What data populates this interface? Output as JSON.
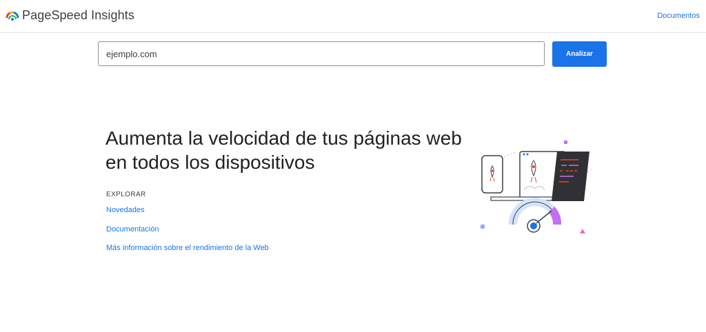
{
  "header": {
    "app_title": "PageSpeed Insights",
    "docs_link": "Documentos"
  },
  "search": {
    "value": "ejemplo.com",
    "button_label": "Analizar"
  },
  "hero": {
    "title_line1": "Aumenta la velocidad de tus páginas web",
    "title_line2": "en todos los dispositivos"
  },
  "explore": {
    "label": "EXPLORAR",
    "links": [
      "Novedades",
      "Documentación",
      "Más información sobre el rendimiento de la Web"
    ]
  },
  "colors": {
    "accent": "#1a73e8",
    "gauge_purple": "#c46ff0",
    "gauge_blue": "#1a73e8"
  },
  "icons": {
    "logo": "pagespeed-logo-icon",
    "illustration": "speed-devices-illustration"
  }
}
